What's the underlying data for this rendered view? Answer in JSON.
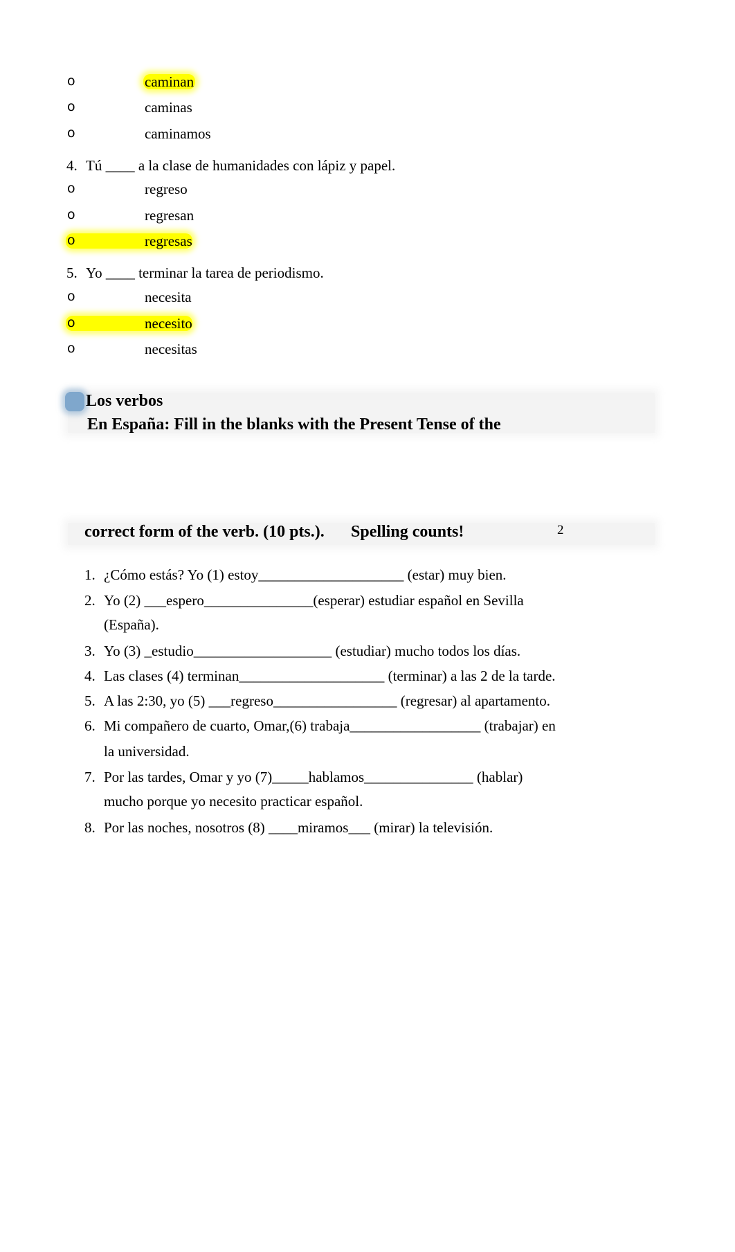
{
  "quiz": {
    "q3_options": [
      {
        "bullet": "o",
        "text": "caminan",
        "highlighted": true
      },
      {
        "bullet": "o",
        "text": "caminas",
        "highlighted": false
      },
      {
        "bullet": "o",
        "text": "caminamos",
        "highlighted": false
      }
    ],
    "q4": {
      "number": "4.",
      "prompt": "Tú ____ a la clase de humanidades con lápiz y papel.",
      "options": [
        {
          "bullet": "o",
          "text": "regreso",
          "highlighted": false
        },
        {
          "bullet": "o",
          "text": "regresan",
          "highlighted": false
        },
        {
          "bullet": "o",
          "text": "regresas",
          "highlighted": true
        }
      ]
    },
    "q5": {
      "number": "5.",
      "prompt": "Yo ____ terminar la tarea de periodismo.",
      "options": [
        {
          "bullet": "o",
          "text": "necesita",
          "highlighted": false
        },
        {
          "bullet": "o",
          "text": "necesito",
          "highlighted": true
        },
        {
          "bullet": "o",
          "text": "necesitas",
          "highlighted": false
        }
      ]
    }
  },
  "section": {
    "title": "Los verbos",
    "instruction_line1": "En España: Fill in the blanks with the Present Tense of the",
    "instruction_line2": "correct form of the verb. (10 pts.).",
    "spelling_note": "Spelling counts!",
    "page_number": "2"
  },
  "fill_in": [
    {
      "number": "1.",
      "lines": [
        "¿Cómo estás? Yo (1) estoy____________________ (estar) muy bien."
      ]
    },
    {
      "number": "2.",
      "lines": [
        "Yo (2) ___espero_______________(esperar) estudiar español en Sevilla",
        "(España)."
      ]
    },
    {
      "number": "3.",
      "lines": [
        "Yo (3) _estudio___________________ (estudiar) mucho todos los días."
      ]
    },
    {
      "number": "4.",
      "lines": [
        "Las clases (4) terminan____________________ (terminar) a las 2 de la tarde."
      ]
    },
    {
      "number": "5.",
      "lines": [
        "A las 2:30, yo (5) ___regreso_________________ (regresar) al apartamento."
      ]
    },
    {
      "number": "6.",
      "lines": [
        "Mi compañero de cuarto, Omar,(6) trabaja__________________ (trabajar) en",
        "la universidad."
      ]
    },
    {
      "number": "7.",
      "lines": [
        "Por las tardes, Omar y yo (7)_____hablamos_______________ (hablar)",
        "mucho porque yo necesito practicar español."
      ]
    },
    {
      "number": "8.",
      "lines": [
        "Por las noches, nosotros (8) ____miramos___ (mirar) la televisión."
      ]
    }
  ],
  "colors": {
    "highlight": "#ffff00",
    "banner": "#f3f3f3",
    "marker": "#7fa7cc"
  }
}
